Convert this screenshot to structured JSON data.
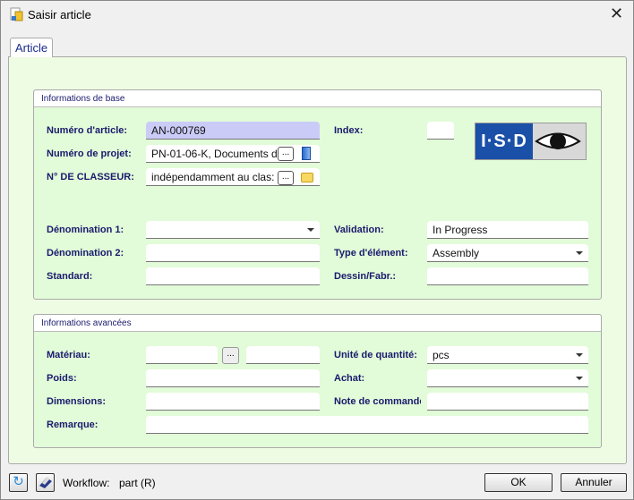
{
  "window": {
    "title": "Saisir article",
    "close_icon": "close-icon"
  },
  "tabs": [
    {
      "label": "Article",
      "active": true
    }
  ],
  "basic": {
    "title": "Informations de base",
    "article_number": {
      "label": "Numéro d'article:",
      "value": "AN-000769"
    },
    "project_number": {
      "label": "Numéro de projet:",
      "value": "PN-01-06-K, Documents d"
    },
    "folder": {
      "label": "N° DE CLASSEUR:",
      "value": "indépendamment au clas:"
    },
    "index": {
      "label": "Index:",
      "value": ""
    },
    "designation1": {
      "label": "Dénomination 1:",
      "value": ""
    },
    "designation2": {
      "label": "Dénomination 2:",
      "value": ""
    },
    "standard": {
      "label": "Standard:",
      "value": ""
    },
    "validation": {
      "label": "Validation:",
      "value": "In Progress"
    },
    "element_type": {
      "label": "Type d'élément:",
      "value": "Assembly"
    },
    "drawing": {
      "label": "Dessin/Fabr.:",
      "value": ""
    },
    "logo": "I·S·D"
  },
  "advanced": {
    "title": "Informations avancées",
    "material": {
      "label": "Matériau:",
      "value": "",
      "value2": ""
    },
    "weight": {
      "label": "Poids:",
      "value": ""
    },
    "dimensions": {
      "label": "Dimensions:",
      "value": ""
    },
    "remark": {
      "label": "Remarque:",
      "value": ""
    },
    "unit": {
      "label": "Unité de quantité:",
      "value": "pcs"
    },
    "purchase": {
      "label": "Achat:",
      "value": ""
    },
    "order_note": {
      "label": "Note de commande:",
      "value": ""
    }
  },
  "footer": {
    "workflow_label": "Workflow:",
    "workflow_value": "part (R)",
    "ok": "OK",
    "cancel": "Annuler"
  },
  "browse_label": "..."
}
